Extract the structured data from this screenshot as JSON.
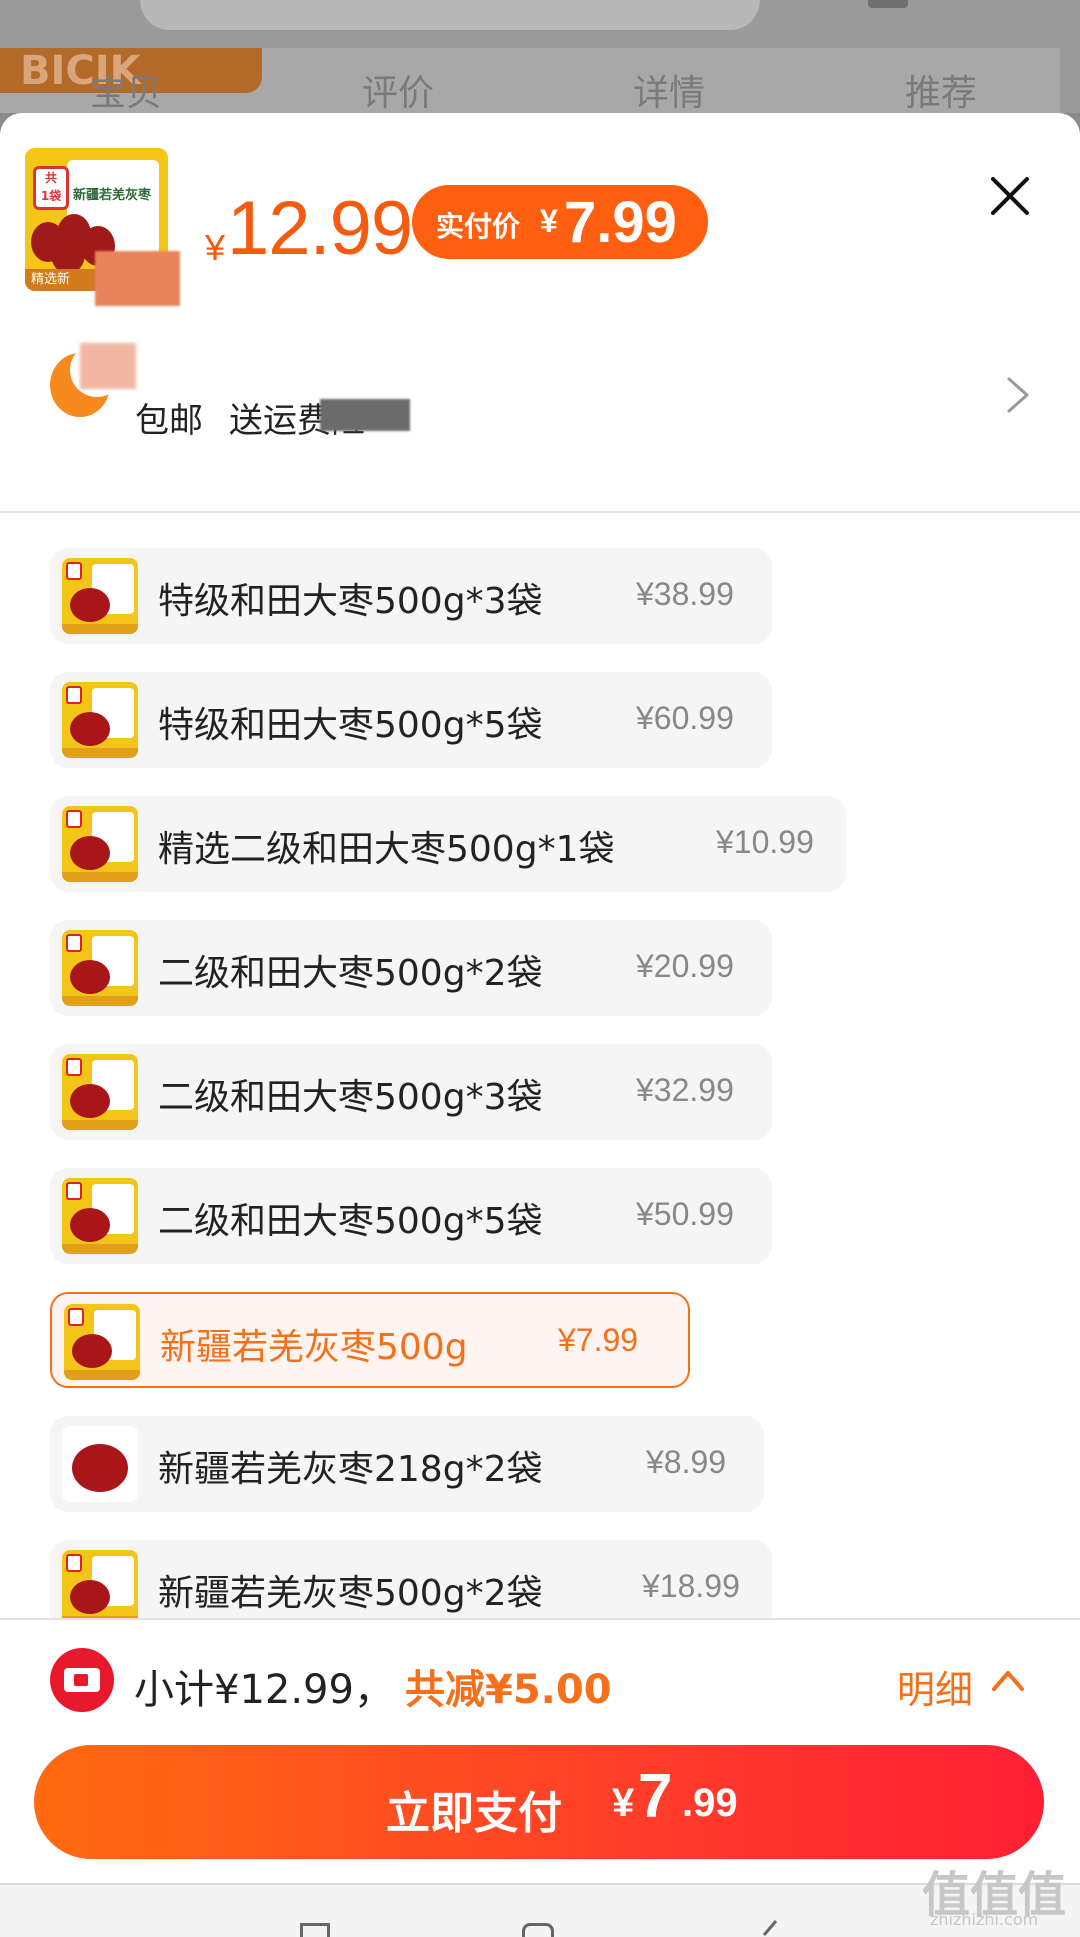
{
  "background": {
    "brand_text": "BICIK",
    "tabs": [
      "宝贝",
      "评价",
      "详情",
      "推荐"
    ]
  },
  "product": {
    "thumb_count": "共\n1袋",
    "thumb_title": "新疆若羌灰枣",
    "thumb_caption": "精选新",
    "currency": "¥",
    "price": "12.99",
    "paid_label": "实付价",
    "paid_currency": "¥",
    "paid_price": "7.99"
  },
  "promo": {
    "items": [
      "包邮",
      "送运费险"
    ]
  },
  "sku_list": [
    {
      "name": "特级和田大枣500g*3袋",
      "price": "¥38.99",
      "selected": false
    },
    {
      "name": "特级和田大枣500g*5袋",
      "price": "¥60.99",
      "selected": false
    },
    {
      "name": "精选二级和田大枣500g*1袋",
      "price": "¥10.99",
      "selected": false
    },
    {
      "name": "二级和田大枣500g*2袋",
      "price": "¥20.99",
      "selected": false
    },
    {
      "name": "二级和田大枣500g*3袋",
      "price": "¥32.99",
      "selected": false
    },
    {
      "name": "二级和田大枣500g*5袋",
      "price": "¥50.99",
      "selected": false
    },
    {
      "name": "新疆若羌灰枣500g",
      "price": "¥7.99",
      "selected": true
    },
    {
      "name": "新疆若羌灰枣218g*2袋",
      "price": "¥8.99",
      "selected": false
    },
    {
      "name": "新疆若羌灰枣500g*2袋",
      "price": "¥18.99",
      "selected": false
    }
  ],
  "summary": {
    "subtotal": "小计¥12.99，",
    "discount": "共减¥5.00",
    "detail_label": "明细"
  },
  "pay_button": {
    "label": "立即支付",
    "currency": "¥",
    "int": "7",
    "dec": ".99"
  },
  "watermark": {
    "text": "值值值",
    "sub": "zhizhizhi.com"
  },
  "colors": {
    "accent": "#f4701b",
    "price": "#f45b0e",
    "pay_start": "#ff6b10",
    "pay_end": "#ff1f35"
  }
}
